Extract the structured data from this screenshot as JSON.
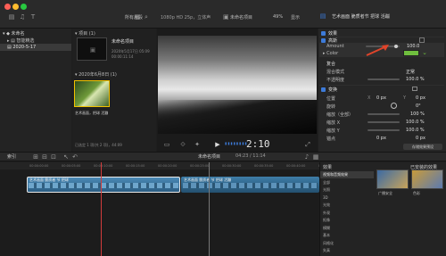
{
  "titlebar": {
    "library_filter": "所有片段",
    "viewer_format": "1080p HD 25p，立体声",
    "project_name": "未命名项目",
    "zoom": "49%",
    "view_menu": "显示",
    "inspector_title": "艺术画面 脆质者节 把球 活蹦"
  },
  "sidebar": {
    "library": "未命名",
    "smart_collection": "智能精选",
    "event": "2020-5-17"
  },
  "browser": {
    "project_section": "项目",
    "project_count": "(1)",
    "project_name": "未命名项目",
    "project_date": "2020年5月17日 05:09",
    "project_duration": "00:00:11:14",
    "date_section": "2020年6月8日",
    "date_count": "(1)",
    "clip_name": "艺术画面，把球 活蹦",
    "status": "已选定 1 项(共 2 项)，44:09"
  },
  "viewer": {
    "timecode": "2:10"
  },
  "inspector": {
    "section_effect": "效果",
    "section_blur": "高斯",
    "amount_label": "Amount",
    "amount_value": "100.0",
    "color_label": "Color",
    "section_composite": "复合",
    "blend_mode_label": "混合模式",
    "blend_mode_value": "正常",
    "opacity_label": "不透明度",
    "opacity_value": "100.0 %",
    "section_transform": "变换",
    "position_label": "位置",
    "position_x_label": "X",
    "position_x_value": "0 px",
    "position_y_label": "Y",
    "position_y_value": "0 px",
    "rotation_label": "旋转",
    "rotation_value": "0°",
    "scale_all_label": "缩放（全部）",
    "scale_all_value": "100 %",
    "scale_x_label": "缩放 X",
    "scale_x_value": "100.0 %",
    "scale_y_label": "缩放 Y",
    "scale_y_value": "100.0 %",
    "anchor_label": "锚点",
    "anchor_x_value": "0 px",
    "anchor_y_value": "0 px",
    "save_effect_button": "存储效果预设"
  },
  "timeline_toolbar": {
    "index": "索引",
    "project": "未命名项目",
    "duration": "04:23 / 11:14"
  },
  "timeline": {
    "clip_label_1": "艺术画面 脆质者 节 把球",
    "clip_label_2": "艺术画面 脆质者 节 把球 活蹦",
    "ruler_labels": [
      "00:00:00:00",
      "00:00:05:00",
      "00:00:10:00",
      "00:00:15:00",
      "00:00:20:00",
      "00:00:25:00",
      "00:00:30:00",
      "00:00:35:00",
      "00:00:40:00",
      "00:00:45:00"
    ]
  },
  "effects": {
    "header": "效果",
    "installed": "已安装的效果",
    "categories": [
      "视频和音频效果",
      "全部",
      "光照",
      "3D",
      "光效",
      "外观",
      "抠像",
      "模糊",
      "基本",
      "风格化",
      "失真"
    ],
    "item_1": "广播安全",
    "item_2": "色彩"
  },
  "colors": {
    "accent": "#3d7bd9",
    "playhead": "#d23c3c",
    "clip_blue": "#3e7da8",
    "arrow": "#e0442a",
    "color_swatch": "#6fbe3e"
  }
}
